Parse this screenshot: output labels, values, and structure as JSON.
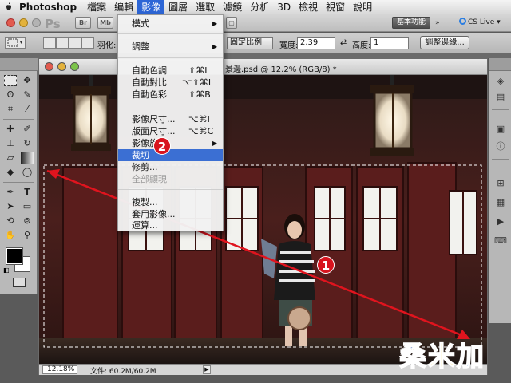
{
  "menubar": {
    "app_name": "Photoshop",
    "items": [
      "檔案",
      "編輯",
      "影像",
      "圖層",
      "選取",
      "濾鏡",
      "分析",
      "3D",
      "檢視",
      "視窗",
      "說明"
    ]
  },
  "appbar": {
    "logo": "Ps",
    "buttons": [
      "Br",
      "Mb"
    ],
    "workspace": "基本功能",
    "cs_live": "CS Live"
  },
  "options": {
    "feather_label": "羽化:",
    "style_value": "固定比例",
    "width_label": "寬度:",
    "width_value": "2.39",
    "height_label": "高度:",
    "height_value": "1",
    "refine_button": "調整邊緣..."
  },
  "document": {
    "title": "景邊.psd @ 12.2% (RGB/8) *",
    "zoom": "12.18%",
    "doc_info": "文件: 60.2M/60.2M"
  },
  "image_menu": {
    "items": [
      {
        "label": "模式",
        "shortcut": "",
        "submenu": "▶",
        "state": "normal"
      },
      {
        "label": "調整",
        "shortcut": "",
        "submenu": "▶",
        "state": "normal"
      },
      {
        "label": "自動色調",
        "shortcut": "⇧⌘L",
        "submenu": "",
        "state": "normal"
      },
      {
        "label": "自動對比",
        "shortcut": "⌥⇧⌘L",
        "submenu": "",
        "state": "normal"
      },
      {
        "label": "自動色彩",
        "shortcut": "⇧⌘B",
        "submenu": "",
        "state": "normal"
      },
      {
        "label": "影像尺寸...",
        "shortcut": "⌥⌘I",
        "submenu": "",
        "state": "normal"
      },
      {
        "label": "版面尺寸...",
        "shortcut": "⌥⌘C",
        "submenu": "",
        "state": "normal"
      },
      {
        "label": "影像旋轉",
        "shortcut": "",
        "submenu": "▶",
        "state": "normal"
      },
      {
        "label": "裁切",
        "shortcut": "",
        "submenu": "",
        "state": "highlighted"
      },
      {
        "label": "修剪...",
        "shortcut": "",
        "submenu": "",
        "state": "normal"
      },
      {
        "label": "全部顯現",
        "shortcut": "",
        "submenu": "",
        "state": "disabled"
      },
      {
        "label": "複製...",
        "shortcut": "",
        "submenu": "",
        "state": "normal"
      },
      {
        "label": "套用影像...",
        "shortcut": "",
        "submenu": "",
        "state": "normal"
      },
      {
        "label": "運算...",
        "shortcut": "",
        "submenu": "",
        "state": "normal"
      }
    ]
  },
  "annotations": {
    "step_1": "1",
    "step_2": "2",
    "arrow_color": "#e0141e"
  },
  "watermark": {
    "characters": [
      "桑",
      "米",
      "加"
    ],
    "colors": [
      "#1f4aa8",
      "#f2c200",
      "#1e6fd0"
    ]
  },
  "colors": {
    "menu_highlight": "#3b6fd3",
    "foreground": "#000000",
    "background": "#ffffff"
  }
}
